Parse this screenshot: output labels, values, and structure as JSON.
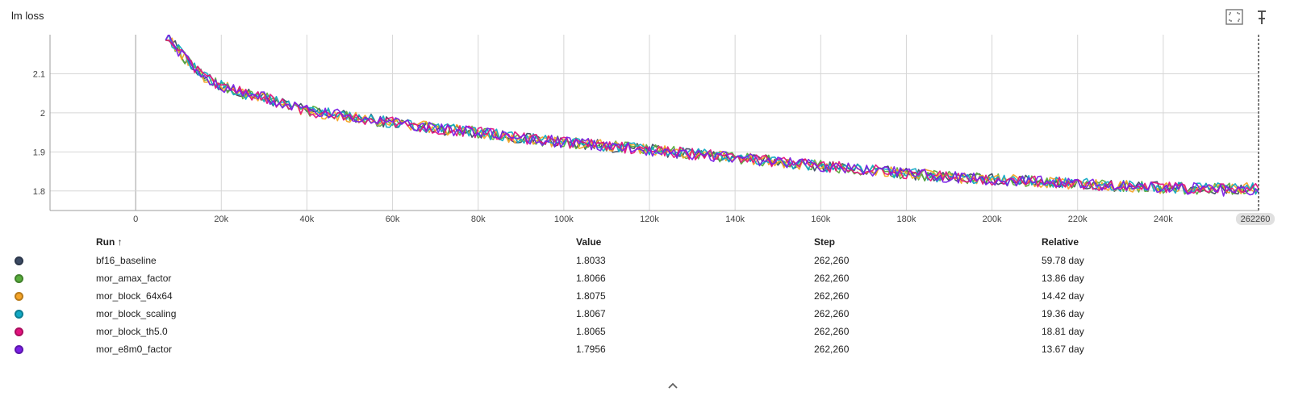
{
  "title": "lm loss",
  "icons": {
    "fullscreen": "fullscreen-icon",
    "pin": "pin-icon",
    "collapse": "chevron-up-icon"
  },
  "chart_data": {
    "type": "line",
    "title": "lm loss",
    "xlabel": "",
    "ylabel": "",
    "xlim": [
      -20000,
      262260
    ],
    "ylim": [
      1.75,
      2.2
    ],
    "x_ticks": [
      "0",
      "20k",
      "40k",
      "60k",
      "80k",
      "100k",
      "120k",
      "140k",
      "160k",
      "180k",
      "200k",
      "220k",
      "240k"
    ],
    "x_tick_values": [
      0,
      20000,
      40000,
      60000,
      80000,
      100000,
      120000,
      140000,
      160000,
      180000,
      200000,
      220000,
      240000
    ],
    "y_ticks": [
      "1.8",
      "1.9",
      "2",
      "2.1"
    ],
    "y_tick_values": [
      1.8,
      1.9,
      2.0,
      2.1
    ],
    "grid": true,
    "cursor_label": "262260",
    "cursor_x": 262260,
    "x": [
      7000,
      10000,
      13000,
      16000,
      20000,
      25000,
      30000,
      35000,
      40000,
      50000,
      60000,
      70000,
      80000,
      90000,
      100000,
      110000,
      120000,
      130000,
      140000,
      150000,
      160000,
      170000,
      180000,
      190000,
      200000,
      210000,
      220000,
      230000,
      240000,
      250000,
      262260
    ],
    "series": [
      {
        "name": "bf16_baseline",
        "color": "#3b4a63",
        "values": [
          2.2,
          2.16,
          2.12,
          2.09,
          2.07,
          2.05,
          2.04,
          2.02,
          2.005,
          1.99,
          1.975,
          1.96,
          1.95,
          1.935,
          1.925,
          1.915,
          1.905,
          1.895,
          1.885,
          1.875,
          1.865,
          1.855,
          1.845,
          1.835,
          1.83,
          1.825,
          1.818,
          1.813,
          1.808,
          1.805,
          1.8033
        ]
      },
      {
        "name": "mor_amax_factor",
        "color": "#58ad3c",
        "values": [
          2.2,
          2.16,
          2.12,
          2.09,
          2.07,
          2.05,
          2.04,
          2.02,
          2.005,
          1.99,
          1.975,
          1.96,
          1.95,
          1.935,
          1.925,
          1.915,
          1.905,
          1.895,
          1.885,
          1.875,
          1.865,
          1.855,
          1.845,
          1.835,
          1.83,
          1.825,
          1.818,
          1.813,
          1.808,
          1.805,
          1.8066
        ]
      },
      {
        "name": "mor_block_64x64",
        "color": "#f5a427",
        "values": [
          2.2,
          2.16,
          2.12,
          2.09,
          2.07,
          2.05,
          2.04,
          2.02,
          2.005,
          1.99,
          1.975,
          1.96,
          1.95,
          1.935,
          1.925,
          1.915,
          1.905,
          1.895,
          1.885,
          1.875,
          1.865,
          1.855,
          1.845,
          1.835,
          1.83,
          1.825,
          1.818,
          1.813,
          1.808,
          1.805,
          1.8075
        ]
      },
      {
        "name": "mor_block_scaling",
        "color": "#11a9c4",
        "values": [
          2.2,
          2.16,
          2.12,
          2.09,
          2.07,
          2.05,
          2.04,
          2.02,
          2.005,
          1.99,
          1.975,
          1.96,
          1.95,
          1.935,
          1.925,
          1.915,
          1.905,
          1.895,
          1.885,
          1.875,
          1.865,
          1.855,
          1.845,
          1.835,
          1.83,
          1.825,
          1.818,
          1.813,
          1.808,
          1.805,
          1.8067
        ]
      },
      {
        "name": "mor_block_th5.0",
        "color": "#e3127e",
        "values": [
          2.2,
          2.16,
          2.12,
          2.09,
          2.07,
          2.05,
          2.04,
          2.02,
          2.005,
          1.99,
          1.975,
          1.96,
          1.95,
          1.935,
          1.925,
          1.915,
          1.905,
          1.895,
          1.885,
          1.875,
          1.865,
          1.855,
          1.845,
          1.835,
          1.83,
          1.825,
          1.818,
          1.813,
          1.808,
          1.805,
          1.8065
        ]
      },
      {
        "name": "mor_e8m0_factor",
        "color": "#7b1fe6",
        "values": [
          2.2,
          2.16,
          2.12,
          2.09,
          2.07,
          2.05,
          2.04,
          2.02,
          2.005,
          1.99,
          1.975,
          1.96,
          1.95,
          1.935,
          1.925,
          1.915,
          1.905,
          1.895,
          1.885,
          1.875,
          1.865,
          1.855,
          1.845,
          1.835,
          1.83,
          1.825,
          1.818,
          1.813,
          1.808,
          1.805,
          1.7956
        ]
      }
    ]
  },
  "table": {
    "headers": {
      "run": "Run ↑",
      "value": "Value",
      "step": "Step",
      "relative": "Relative"
    },
    "rows": [
      {
        "run": "bf16_baseline",
        "value": "1.8033",
        "step": "262,260",
        "relative": "59.78 day",
        "color": "#3b4a63"
      },
      {
        "run": "mor_amax_factor",
        "value": "1.8066",
        "step": "262,260",
        "relative": "13.86 day",
        "color": "#58ad3c"
      },
      {
        "run": "mor_block_64x64",
        "value": "1.8075",
        "step": "262,260",
        "relative": "14.42 day",
        "color": "#f5a427"
      },
      {
        "run": "mor_block_scaling",
        "value": "1.8067",
        "step": "262,260",
        "relative": "19.36 day",
        "color": "#11a9c4"
      },
      {
        "run": "mor_block_th5.0",
        "value": "1.8065",
        "step": "262,260",
        "relative": "18.81 day",
        "color": "#e3127e"
      },
      {
        "run": "mor_e8m0_factor",
        "value": "1.7956",
        "step": "262,260",
        "relative": "13.67 day",
        "color": "#7b1fe6"
      }
    ]
  }
}
